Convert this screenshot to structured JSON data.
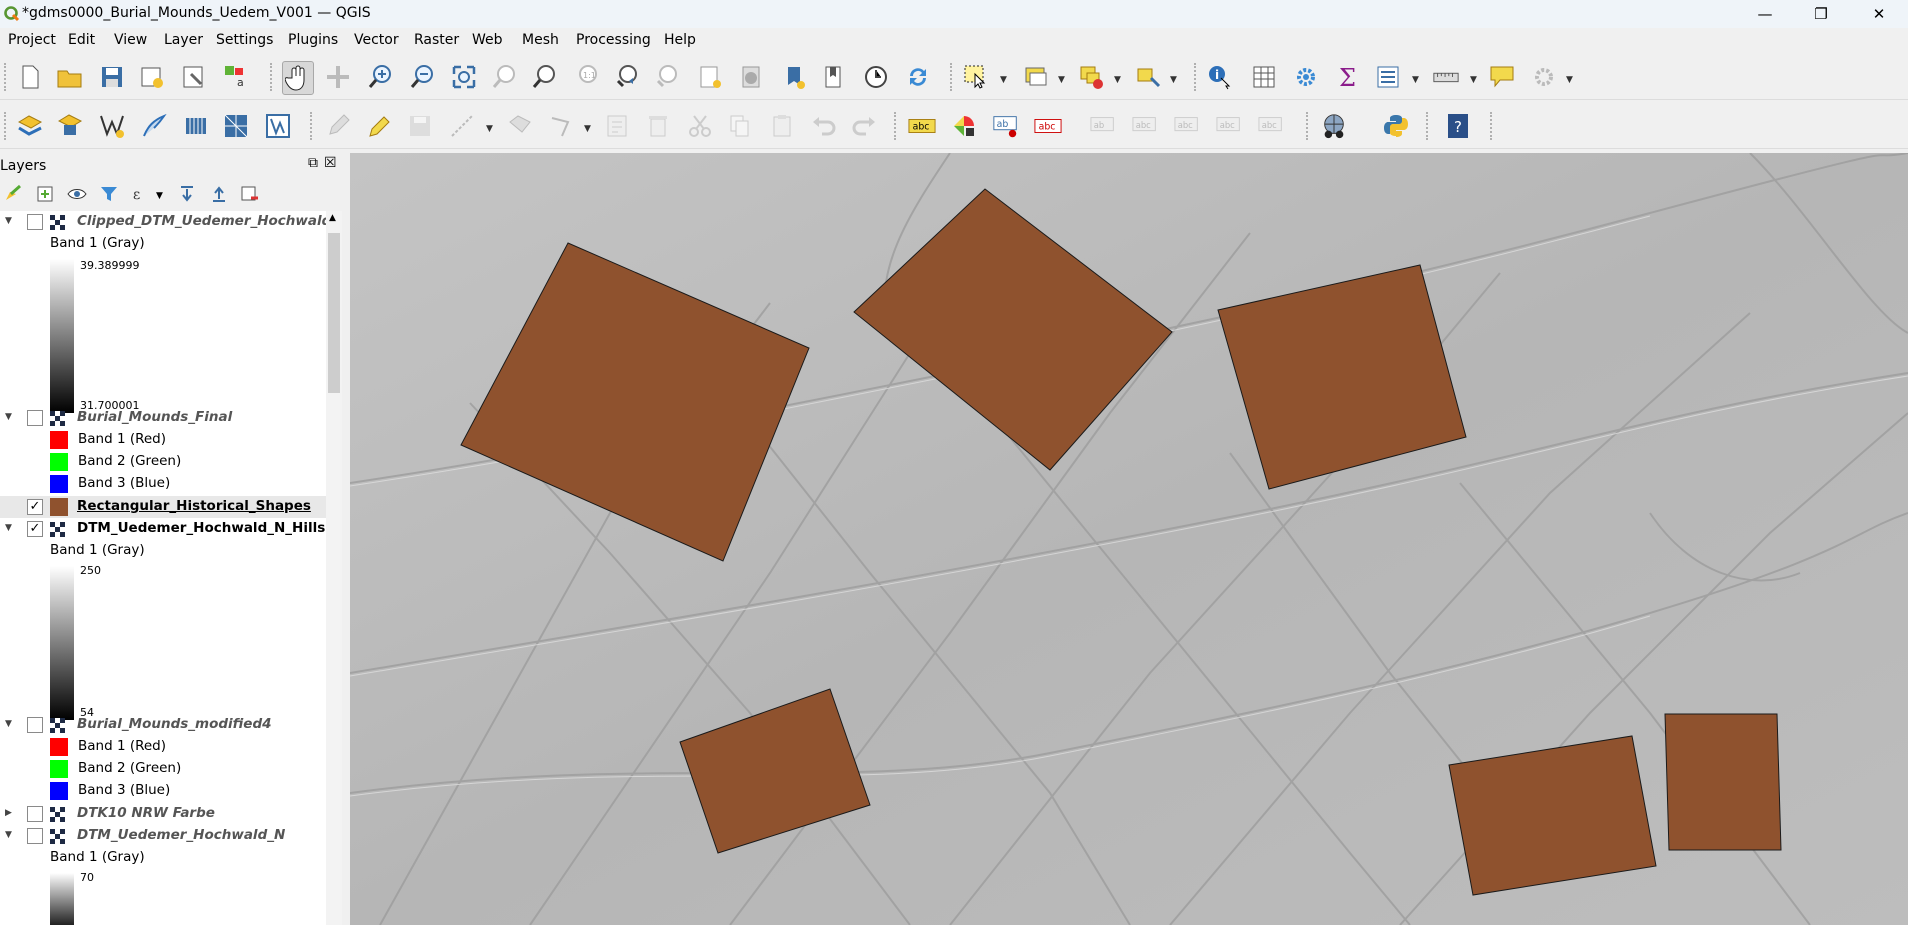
{
  "window": {
    "title": "*gdms0000_Burial_Mounds_Uedem_V001 — QGIS",
    "minimize": "—",
    "maximize": "❐",
    "close": "✕"
  },
  "menubar": {
    "items": [
      "Project",
      "Edit",
      "View",
      "Layer",
      "Settings",
      "Plugins",
      "Vector",
      "Raster",
      "Web",
      "Mesh",
      "Processing",
      "Help"
    ]
  },
  "layers_panel": {
    "title": "Layers",
    "float_icon": "⧉",
    "close_icon": "☒",
    "layers": [
      {
        "name": "Clipped_DTM_Uedemer_Hochwald_",
        "checked": false,
        "style": "italic",
        "band": "Band 1 (Gray)",
        "max": "39.389999",
        "min": "31.700001"
      },
      {
        "name": "Burial_Mounds_Final",
        "checked": false,
        "style": "italic",
        "bands": [
          "Band 1 (Red)",
          "Band 2 (Green)",
          "Band 3 (Blue)"
        ]
      },
      {
        "name": "Rectangular_Historical_Shapes",
        "checked": true,
        "style": "bold"
      },
      {
        "name": "DTM_Uedemer_Hochwald_N_Hillsha",
        "checked": true,
        "style": "bold",
        "band": "Band 1 (Gray)",
        "max": "250",
        "min": "54"
      },
      {
        "name": "Burial_Mounds_modified4",
        "checked": false,
        "style": "italic",
        "bands": [
          "Band 1 (Red)",
          "Band 2 (Green)",
          "Band 3 (Blue)"
        ]
      },
      {
        "name": "DTK10 NRW Farbe",
        "checked": false,
        "style": "italic"
      },
      {
        "name": "DTM_Uedemer_Hochwald_N",
        "checked": false,
        "style": "italic",
        "band": "Band 1 (Gray)",
        "max": "70"
      }
    ],
    "check_mark": "✓"
  },
  "colors": {
    "shape_fill": "#8f522e",
    "band_red": "#ff0000",
    "band_green": "#00ff00",
    "band_blue": "#0000ff"
  },
  "icons": {
    "toolbar1": [
      "new-project",
      "open-project",
      "save-project",
      "new-print-layout",
      "layout-manager",
      "style-manager",
      "pan",
      "pan-to-selection",
      "zoom-in",
      "zoom-out",
      "zoom-full",
      "zoom-to-selection",
      "zoom-to-layer",
      "zoom-native",
      "zoom-last",
      "zoom-next",
      "new-bookmark",
      "show-bookmarks",
      "temporal-controller",
      "refresh",
      "select-features",
      "select-by-value",
      "deselect",
      "select-by-location",
      "identify",
      "attribute-table",
      "processing-toolbox",
      "statistics",
      "open-table",
      "measure",
      "map-tips",
      "settings-disabled"
    ],
    "toolbar2": [
      "add-vector-layer",
      "add-raster-layer",
      "new-shapefile",
      "digitize",
      "virtual-layer",
      "add-wms",
      "add-wcs",
      "edit-toggle",
      "pencil",
      "save-edits",
      "digitize-line",
      "add-feature",
      "vertex-tool",
      "modify-attributes",
      "delete-selected",
      "cut",
      "copy",
      "paste",
      "undo",
      "redo",
      "label-tool",
      "layer-diagram",
      "label-pin",
      "label-show-hide",
      "label-move",
      "label-rotate",
      "label-change",
      "label-pin-dis",
      "label-move-dis",
      "globe",
      "python",
      "help"
    ]
  }
}
